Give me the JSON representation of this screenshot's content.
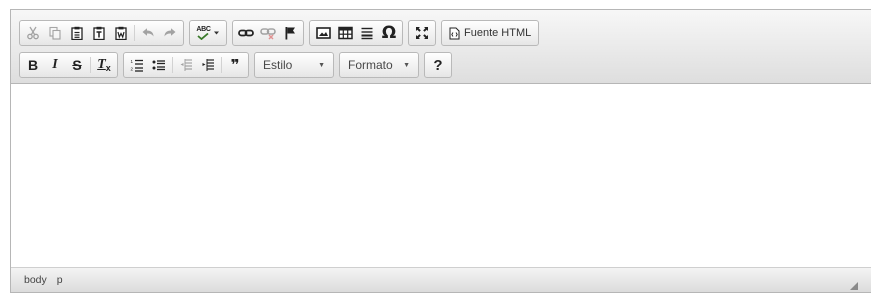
{
  "toolbar": {
    "icons": {
      "cut": "cut-icon",
      "copy": "copy-icon",
      "paste": "paste-icon",
      "paste_text": "paste-text-icon",
      "paste_word": "paste-from-word-icon",
      "undo": "undo-icon",
      "redo": "redo-icon",
      "spellcheck": "spellcheck-icon",
      "link": "link-icon",
      "unlink": "unlink-icon",
      "anchor": "flag-icon",
      "image": "image-icon",
      "table": "table-icon",
      "horizontal_rule": "horizontal-rule-icon",
      "special_char": "omega-icon",
      "maximize": "maximize-icon",
      "source": "source-icon"
    },
    "source_label": "Fuente HTML",
    "spellcheck_badge": "ABC",
    "special_char_glyph": "Ω",
    "help_glyph": "?",
    "style_combo": "Estilo",
    "format_combo": "Formato",
    "bold": "B",
    "italic": "I",
    "strike": "S",
    "remove_format": "T",
    "remove_format_sub": "x",
    "blockquote": "❞"
  },
  "statusbar": {
    "path": [
      "body",
      "p"
    ]
  },
  "colors": {
    "toolbar_top": "#f7f7f7",
    "toolbar_bottom": "#dedede",
    "border": "#b6b6b6"
  }
}
